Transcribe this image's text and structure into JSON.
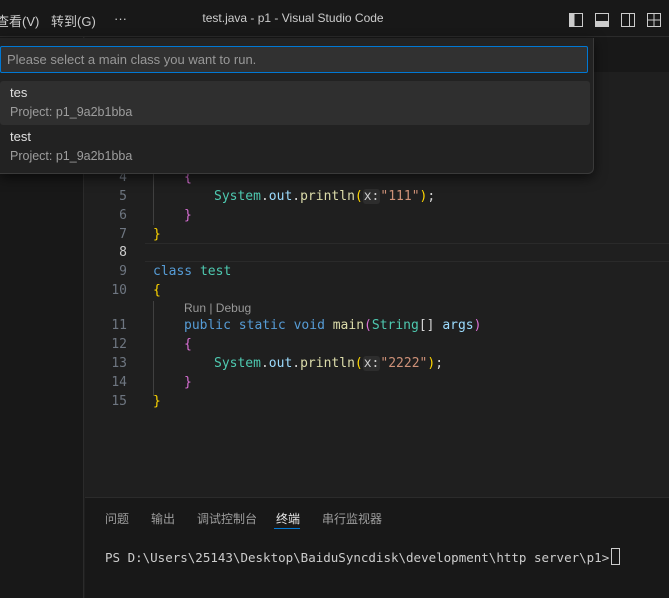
{
  "titlebar": {
    "menu_view": "查看(V)",
    "menu_go": "转到(G)",
    "menu_more": "···",
    "window_title": "test.java - p1 - Visual Studio Code",
    "layout_icons": [
      "toggle-primary-sidebar-icon",
      "toggle-panel-icon",
      "toggle-secondary-sidebar-icon",
      "customize-layout-icon"
    ]
  },
  "quick_pick": {
    "placeholder": "Please select a main class you want to run.",
    "items": [
      {
        "label": "tes",
        "description": "Project: p1_9a2b1bba",
        "selected": true
      },
      {
        "label": "test",
        "description": "Project: p1_9a2b1bba",
        "selected": false
      }
    ]
  },
  "editor": {
    "line_numbers": [
      "4",
      "5",
      "6",
      "7",
      "8",
      "9",
      "10",
      "11",
      "12",
      "13",
      "14",
      "15"
    ],
    "active_line": "8",
    "codelens": "Run | Debug",
    "code": {
      "l4_brace": "{",
      "l5_system": "System",
      "l5_dot1": ".",
      "l5_out": "out",
      "l5_dot2": ".",
      "l5_println": "println",
      "l5_paren_open": "(",
      "l5_hint": "x:",
      "l5_string": "\"111\"",
      "l5_paren_close": ")",
      "l5_semi": ";",
      "l6_brace": "}",
      "l7_brace": "}",
      "l9_class": "class",
      "l9_name": "test",
      "l10_brace": "{",
      "l11_public": "public",
      "l11_static": "static",
      "l11_void": "void",
      "l11_main": "main",
      "l11_paren_open": "(",
      "l11_string_type": "String",
      "l11_brackets": "[]",
      "l11_args": "args",
      "l11_paren_close": ")",
      "l12_brace": "{",
      "l13_system": "System",
      "l13_dot1": ".",
      "l13_out": "out",
      "l13_dot2": ".",
      "l13_println": "println",
      "l13_paren_open": "(",
      "l13_hint": "x:",
      "l13_string": "\"2222\"",
      "l13_paren_close": ")",
      "l13_semi": ";",
      "l14_brace": "}",
      "l15_brace": "}"
    }
  },
  "panel": {
    "tabs": [
      {
        "label": "问题",
        "active": false
      },
      {
        "label": "输出",
        "active": false
      },
      {
        "label": "调试控制台",
        "active": false
      },
      {
        "label": "终端",
        "active": true
      },
      {
        "label": "串行监视器",
        "active": false
      }
    ],
    "terminal_prompt": "PS D:\\Users\\25143\\Desktop\\BaiduSyncdisk\\development\\http server\\p1>"
  },
  "colors": {
    "accent": "#0078d4",
    "keyword": "#569cd6",
    "type": "#4ec9b0",
    "function": "#dcdcaa",
    "string": "#ce9178"
  }
}
